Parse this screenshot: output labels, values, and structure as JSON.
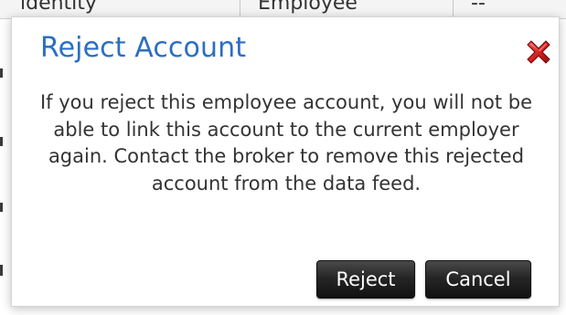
{
  "background": {
    "table_headers": [
      "ldentity",
      "Employee",
      "--"
    ]
  },
  "dialog": {
    "title": "Reject Account",
    "message": "If you reject this employee account, you will not be able to link this account to the current employer again. Contact the broker to remove this rejected account from the data feed.",
    "close_icon": "close-icon",
    "buttons": {
      "reject": "Reject",
      "cancel": "Cancel"
    }
  },
  "colors": {
    "title": "#2b6fc2",
    "close_icon": "#c81e1e",
    "button_bg": "#262626",
    "button_text": "#ffffff"
  }
}
